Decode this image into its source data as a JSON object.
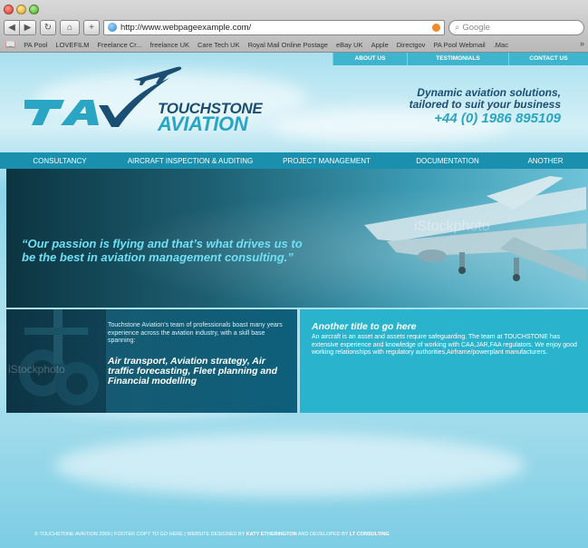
{
  "browser": {
    "url": "http://www.webpageexample.com/",
    "search_placeholder": "Google",
    "buttons": {
      "back": "◀",
      "forward": "▶",
      "reload": "↻",
      "home": "⌂",
      "add": "+"
    },
    "bookmarks": [
      "PA Pool",
      "LOVEFILM",
      "Freelance Cr...",
      "freelance UK",
      "Care Tech UK",
      "Royal Mail Online Postage",
      "eBay UK",
      "Apple",
      "Directgov",
      "PA Pool Webmail",
      ".Mac"
    ],
    "bookmarks_more": "»"
  },
  "site": {
    "top_nav": [
      "ABOUT US",
      "TESTIMONIALS",
      "CONTACT US"
    ],
    "logo": {
      "line1": "TOUCHSTONE",
      "line2": "AVIATION",
      "mark": "TAV"
    },
    "tagline": {
      "line1": "Dynamic aviation solutions,",
      "line2": "tailored to suit your business",
      "phone": "+44 (0) 1986 895109"
    },
    "main_nav": [
      "CONSULTANCY",
      "AIRCRAFT INSPECTION & AUDITING",
      "PROJECT MANAGEMENT",
      "DOCUMENTATION",
      "ANOTHER"
    ],
    "hero": {
      "quote": "“Our passion is flying and that’s what drives us to be the best in aviation management consulting.”",
      "watermark": "iStockphoto"
    },
    "panel_left": {
      "intro": "Touchstone Aviation’s team of professionals boast many years experience across the aviation industry, with a skill base spanning:",
      "skills": "Air transport, Aviation strategy, Air traffic forecasting, Fleet planning  and Financial modelling",
      "watermark": "iStockphoto"
    },
    "panel_right": {
      "title": "Another title to go here",
      "body": "An aircraft is an asset and assets require safeguarding. The team at TOUCHSTONE has extensive experience and knowledge of working with CAA,JAR,FAA regulators. We enjoy good working relationships with regulatory authorities,Airframe/powerplant manufacturers."
    },
    "footer": {
      "text": "© TOUCHSTONE AVAITION 2009  |  FOOTER COPY TO GO HERE  |  WEBSITE DESIGNED BY ",
      "designer": "KATY ETHERINGTON",
      "mid": " AND DEVELOPED BY ",
      "developer": "LT CONSULTING"
    }
  },
  "colors": {
    "brand_dark": "#1b4e73",
    "brand_light": "#2aa5c4",
    "nav_bg": "#1b8fae",
    "panel_right_bg": "#29b3cd"
  }
}
